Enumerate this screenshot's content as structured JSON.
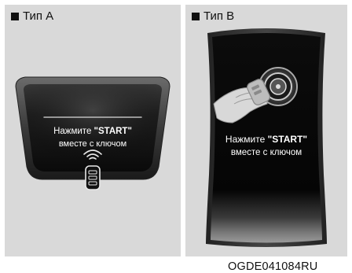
{
  "type_a": {
    "label": "Тип A",
    "prompt_prefix": "Нажмите ",
    "prompt_start": "\"START\"",
    "prompt_line2": "вместе с ключом"
  },
  "type_b": {
    "label": "Тип B",
    "prompt_prefix": "Нажмите ",
    "prompt_start": "\"START\"",
    "prompt_line2": "вместе с ключом"
  },
  "figure_code": "OGDE041084RU"
}
